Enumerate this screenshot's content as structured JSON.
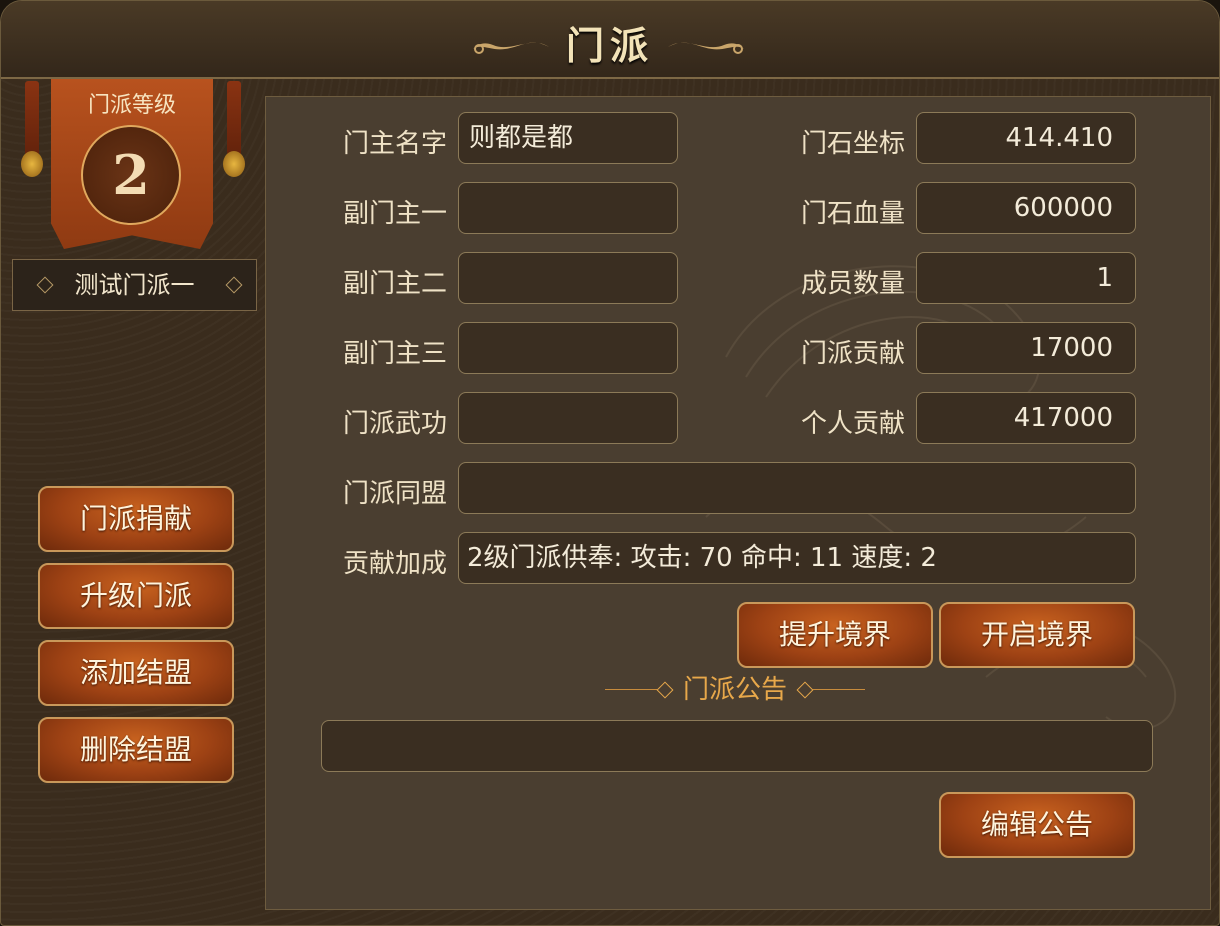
{
  "window": {
    "title": "门派"
  },
  "sidebar": {
    "level_label": "门派等级",
    "level_value": "2",
    "sect_name": "测试门派一",
    "buttons": [
      {
        "label": "门派捐献"
      },
      {
        "label": "升级门派"
      },
      {
        "label": "添加结盟"
      },
      {
        "label": "删除结盟"
      }
    ]
  },
  "info": {
    "left": [
      {
        "label": "门主名字",
        "value": "则都是都"
      },
      {
        "label": "副门主一",
        "value": ""
      },
      {
        "label": "副门主二",
        "value": ""
      },
      {
        "label": "副门主三",
        "value": ""
      },
      {
        "label": "门派武功",
        "value": ""
      }
    ],
    "right": [
      {
        "label": "门石坐标",
        "value": "414.410"
      },
      {
        "label": "门石血量",
        "value": "600000"
      },
      {
        "label": "成员数量",
        "value": "1"
      },
      {
        "label": "门派贡献",
        "value": "17000"
      },
      {
        "label": "个人贡献",
        "value": "417000"
      }
    ],
    "alliance": {
      "label": "门派同盟",
      "value": ""
    },
    "bonus": {
      "label": "贡献加成",
      "value": "2级门派供奉: 攻击: 70 命中: 11 速度: 2"
    }
  },
  "actions": {
    "raise_realm": "提升境界",
    "open_realm": "开启境界"
  },
  "notice": {
    "title": "门派公告",
    "content": "",
    "edit_label": "编辑公告"
  }
}
